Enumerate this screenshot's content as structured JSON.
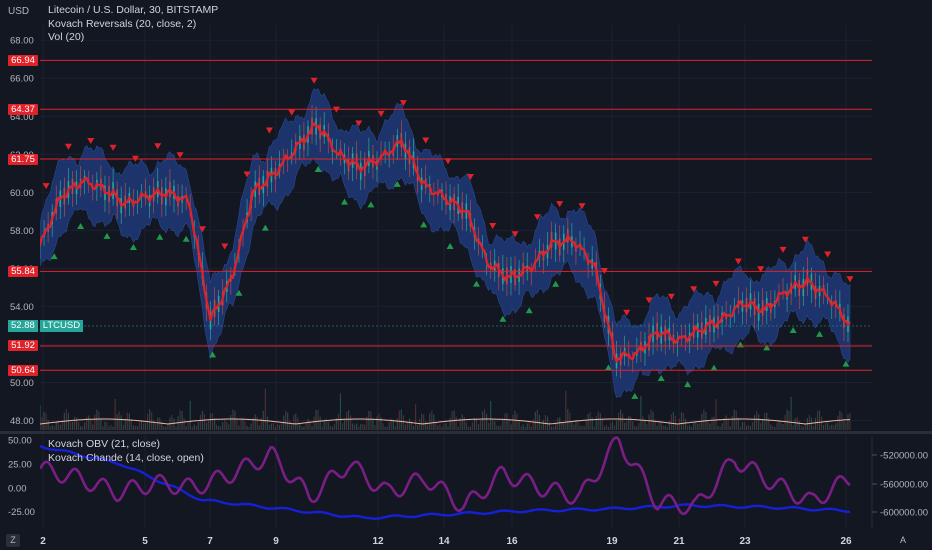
{
  "legend": {
    "main": "Litecoin / U.S. Dollar, 30, BITSTAMP",
    "indicator1": "Kovach Reversals (20, close, 2)",
    "indicator2": "Vol (20)",
    "indicator3": "Kovach OBV (21, close)",
    "indicator4": "Kovach Chande (14, close, open)"
  },
  "currency": "USD",
  "ticker_tag": {
    "price": "52.88",
    "symbol": "LTCUSD"
  },
  "horizontal_levels": [
    {
      "value": 66.94,
      "label": "66.94"
    },
    {
      "value": 64.37,
      "label": "64.37"
    },
    {
      "value": 61.75,
      "label": "61.75"
    },
    {
      "value": 55.84,
      "label": "55.84"
    },
    {
      "value": 51.92,
      "label": "51.92"
    },
    {
      "value": 50.64,
      "label": "50.64"
    }
  ],
  "price_axis_ticks": [
    "68.00",
    "66.00",
    "64.00",
    "62.00",
    "60.00",
    "58.00",
    "56.00",
    "54.00",
    "52.00",
    "50.00",
    "48.00"
  ],
  "osc_left_ticks": [
    "50.00",
    "25.00",
    "0.00",
    "-25.00"
  ],
  "osc_right_ticks": [
    "-520000.00",
    "-560000.00",
    "-600000.00"
  ],
  "time_axis_labels": [
    "2",
    "5",
    "7",
    "9",
    "12",
    "14",
    "16",
    "19",
    "21",
    "23",
    "26"
  ],
  "corner_buttons": {
    "left": "Z",
    "right": "A"
  },
  "colors": {
    "background": "#131722",
    "level_line": "#e0232b",
    "price_main": "#e0232b",
    "band": "#1e3a78",
    "obv": "#1520d8",
    "chande": "#7a1e86",
    "up_marker": "#1f9a4a",
    "down_marker": "#e0232b",
    "ticker": "#26a69a"
  },
  "chart_data": {
    "type": "line",
    "x_labels": [
      "2",
      "5",
      "7",
      "9",
      "12",
      "14",
      "16",
      "19",
      "21",
      "23",
      "26"
    ],
    "series": [
      {
        "values": [
          57.2,
          59.8,
          60.6,
          60.2,
          59.4,
          59.8,
          60.0,
          59.5,
          53.3,
          55.5,
          60.0,
          61.0,
          62.3,
          63.6,
          62.0,
          61.3,
          61.8,
          62.7,
          60.4,
          59.7,
          59.0,
          56.3,
          55.5,
          56.0,
          57.3,
          57.5,
          56.2,
          51.3,
          51.5,
          52.7,
          52.2,
          52.8,
          53.3,
          54.2,
          53.8,
          54.8,
          55.3,
          54.5,
          53.0
        ]
      },
      {
        "values": [
          -0.2,
          -0.3,
          -0.5,
          -0.55,
          -0.6,
          -0.58,
          -0.56,
          -0.55,
          -0.53,
          -0.54,
          -0.56
        ]
      },
      {
        "values": [
          20,
          10,
          -5,
          5,
          0,
          15,
          35,
          -10,
          25,
          -5,
          10,
          -20,
          15,
          0,
          -10,
          50,
          -15,
          -20,
          30,
          5,
          -15,
          10
        ]
      }
    ],
    "ylim": [
      47.5,
      68.8
    ]
  }
}
